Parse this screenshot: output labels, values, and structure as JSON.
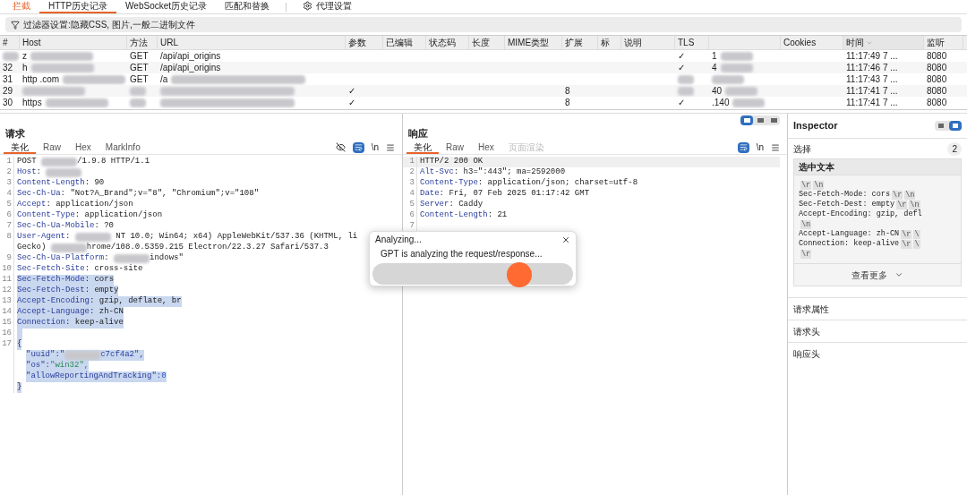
{
  "top_tabs": [
    {
      "kind": "tab",
      "label": "拦截",
      "selected": false,
      "alert": true
    },
    {
      "kind": "tab",
      "label": "HTTP历史记录",
      "selected": true,
      "alert": false
    },
    {
      "kind": "tab",
      "label": "WebSocket历史记录",
      "selected": false,
      "alert": false
    },
    {
      "kind": "tab",
      "label": "匹配和替换",
      "selected": false,
      "alert": false
    },
    {
      "kind": "settings",
      "label": "代理设置",
      "selected": false,
      "alert": false
    }
  ],
  "filter": {
    "text": "过滤器设置:隐藏CSS, 图片,一般二进制文件"
  },
  "table": {
    "columns": [
      {
        "label": "#",
        "sorted": false
      },
      {
        "label": "Host",
        "sorted": false
      },
      {
        "label": "方法",
        "sorted": false
      },
      {
        "label": "URL",
        "sorted": false
      },
      {
        "label": "参数",
        "sorted": false
      },
      {
        "label": "已编辑",
        "sorted": false
      },
      {
        "label": "状态码",
        "sorted": false
      },
      {
        "label": "长度",
        "sorted": false
      },
      {
        "label": "MIME类型",
        "sorted": false
      },
      {
        "label": "扩展",
        "sorted": false
      },
      {
        "label": "标",
        "sorted": false
      },
      {
        "label": "说明",
        "sorted": false
      },
      {
        "label": "TLS",
        "sorted": false
      },
      {
        "sorted": false
      },
      {
        "label": "Cookies",
        "sorted": false
      },
      {
        "label": "时间",
        "sorted": true
      },
      {
        "label": "监听",
        "sorted": false
      }
    ],
    "rows": [
      {
        "cells": [
          {
            "redacted": true
          },
          {
            "text": "z",
            "redacted": true
          },
          {
            "text": "GET",
            "redacted": false
          },
          {
            "text": "/api/api_origins",
            "redacted": false
          },
          null,
          null,
          null,
          null,
          null,
          null,
          null,
          null,
          {
            "text": "✓",
            "redacted": false
          },
          {
            "text": "1",
            "redacted": true
          },
          null,
          {
            "text": "11:17:49 7 ...",
            "redacted": false
          },
          {
            "text": "8080",
            "redacted": false
          }
        ]
      },
      {
        "cells": [
          {
            "text": "32",
            "redacted": false
          },
          {
            "text": "h",
            "redacted": true
          },
          {
            "text": "GET",
            "redacted": false
          },
          {
            "text": "/api/api_origins",
            "redacted": false
          },
          null,
          null,
          null,
          null,
          null,
          null,
          null,
          null,
          {
            "text": "✓",
            "redacted": false
          },
          {
            "text": "4",
            "redacted": true
          },
          null,
          {
            "text": "11:17:46 7 ...",
            "redacted": false
          },
          {
            "text": "8080",
            "redacted": false
          }
        ]
      },
      {
        "cells": [
          {
            "text": "31",
            "redacted": false
          },
          {
            "text": "http .com",
            "redacted": true
          },
          {
            "text": "GET",
            "redacted": false
          },
          {
            "text": "/a",
            "redacted": true
          },
          null,
          null,
          null,
          null,
          null,
          null,
          null,
          null,
          {
            "redacted": true
          },
          {
            "redacted": true
          },
          null,
          {
            "text": "11:17:43 7 ...",
            "redacted": false
          },
          {
            "text": "8080",
            "redacted": false
          }
        ]
      },
      {
        "cells": [
          {
            "text": "29",
            "redacted": false
          },
          {
            "redacted": true
          },
          {
            "redacted": true
          },
          {
            "redacted": true
          },
          {
            "text": "✓",
            "redacted": false
          },
          null,
          null,
          null,
          null,
          {
            "text": "8",
            "redacted": false
          },
          null,
          null,
          {
            "redacted": true
          },
          {
            "text": "40",
            "redacted": true
          },
          null,
          {
            "text": "11:17:41 7 ...",
            "redacted": false
          },
          {
            "text": "8080",
            "redacted": false
          }
        ]
      },
      {
        "cells": [
          {
            "text": "30",
            "redacted": false
          },
          {
            "text": "https",
            "redacted": true
          },
          {
            "redacted": true
          },
          {
            "redacted": true
          },
          {
            "text": "✓",
            "redacted": false
          },
          null,
          null,
          null,
          null,
          {
            "text": "8",
            "redacted": false
          },
          null,
          null,
          {
            "text": "✓",
            "redacted": false
          },
          {
            "text": ".140",
            "redacted": true
          },
          null,
          {
            "text": "11:17:41 7 ...",
            "redacted": false
          },
          {
            "text": "8080",
            "redacted": false
          }
        ]
      }
    ]
  },
  "layout_toggle": [
    {
      "selected": true
    },
    {
      "selected": false
    },
    {
      "selected": false
    }
  ],
  "request": {
    "title": "请求",
    "tabs": [
      {
        "label": "美化",
        "selected": true,
        "disabled": false
      },
      {
        "label": "Raw",
        "selected": false,
        "disabled": false
      },
      {
        "label": "Hex",
        "selected": false,
        "disabled": false
      },
      {
        "label": "MarkInfo",
        "selected": false,
        "disabled": false
      }
    ],
    "tools": {
      "hide_icon": true,
      "wrap_on": true,
      "newline": "\\n"
    },
    "lines": [
      {
        "num": "1",
        "current": false,
        "selected": false,
        "segments": [
          {
            "kind": "plain",
            "text": "POST "
          },
          {
            "kind": "redacted"
          },
          {
            "kind": "plain",
            "text": "/1.9.8 HTTP/1.1"
          }
        ]
      },
      {
        "num": "2",
        "current": false,
        "selected": false,
        "segments": [
          {
            "kind": "key",
            "text": "Host"
          },
          {
            "kind": "plain",
            "text": ": "
          },
          {
            "kind": "redacted"
          }
        ]
      },
      {
        "num": "3",
        "current": false,
        "selected": false,
        "segments": [
          {
            "kind": "key",
            "text": "Content-Length"
          },
          {
            "kind": "plain",
            "text": ": 90"
          }
        ]
      },
      {
        "num": "4",
        "current": false,
        "selected": false,
        "segments": [
          {
            "kind": "key",
            "text": "Sec-Ch-Ua"
          },
          {
            "kind": "plain",
            "text": ": \"Not?A_Brand\";v=\"8\", \"Chromium\";v=\"108\""
          }
        ]
      },
      {
        "num": "5",
        "current": false,
        "selected": false,
        "segments": [
          {
            "kind": "key",
            "text": "Accept"
          },
          {
            "kind": "plain",
            "text": ": application/json"
          }
        ]
      },
      {
        "num": "6",
        "current": false,
        "selected": false,
        "segments": [
          {
            "kind": "key",
            "text": "Content-Type"
          },
          {
            "kind": "plain",
            "text": ": application/json"
          }
        ]
      },
      {
        "num": "7",
        "current": false,
        "selected": false,
        "segments": [
          {
            "kind": "key",
            "text": "Sec-Ch-Ua-Mobile"
          },
          {
            "kind": "plain",
            "text": ": ?0"
          }
        ]
      },
      {
        "num": "8",
        "current": false,
        "selected": false,
        "segments": [
          {
            "kind": "key",
            "text": "User-Agent"
          },
          {
            "kind": "plain",
            "text": ": "
          },
          {
            "kind": "redacted"
          },
          {
            "kind": "plain",
            "text": " NT 10.0; Win64; x64) AppleWebKit/537.36 (KHTML, li"
          }
        ]
      },
      {
        "current": false,
        "selected": false,
        "segments": [
          {
            "kind": "plain",
            "text": "Gecko) "
          },
          {
            "kind": "redacted"
          },
          {
            "kind": "plain",
            "text": "hrome/108.0.5359.215 Electron/22.3.27 Safari/537.3"
          }
        ]
      },
      {
        "num": "9",
        "current": false,
        "selected": false,
        "segments": [
          {
            "kind": "key",
            "text": "Sec-Ch-Ua-Platform"
          },
          {
            "kind": "plain",
            "text": ": "
          },
          {
            "kind": "redacted"
          },
          {
            "kind": "plain",
            "text": "indows\""
          }
        ]
      },
      {
        "num": "10",
        "current": false,
        "selected": false,
        "segments": [
          {
            "kind": "key",
            "text": "Sec-Fetch-Site"
          },
          {
            "kind": "plain",
            "text": ": cross-site"
          }
        ]
      },
      {
        "num": "11",
        "current": false,
        "selected": true,
        "segments": [
          {
            "kind": "key",
            "text": "Sec-Fetch-Mode"
          },
          {
            "kind": "plain",
            "text": ": cors"
          }
        ]
      },
      {
        "num": "12",
        "current": false,
        "selected": true,
        "segments": [
          {
            "kind": "key",
            "text": "Sec-Fetch-Dest"
          },
          {
            "kind": "plain",
            "text": ": empty"
          }
        ]
      },
      {
        "num": "13",
        "current": false,
        "selected": true,
        "segments": [
          {
            "kind": "key",
            "text": "Accept-Encoding"
          },
          {
            "kind": "plain",
            "text": ": gzip, deflate, br"
          }
        ]
      },
      {
        "num": "14",
        "current": false,
        "selected": true,
        "segments": [
          {
            "kind": "key",
            "text": "Accept-Language"
          },
          {
            "kind": "plain",
            "text": ": zh-CN"
          }
        ]
      },
      {
        "num": "15",
        "current": false,
        "selected": true,
        "segments": [
          {
            "kind": "key",
            "text": "Connection"
          },
          {
            "kind": "plain",
            "text": ": keep-alive"
          }
        ]
      },
      {
        "num": "16",
        "current": false,
        "selected": true
      },
      {
        "num": "17",
        "current": false,
        "selected": true,
        "segments": [
          {
            "kind": "plain",
            "text": "{"
          }
        ],
        "children": [
          {
            "current": false,
            "selected": true,
            "segments": [
              {
                "kind": "key",
                "text": "\"uuid\":\""
              },
              {
                "kind": "redacted"
              },
              {
                "kind": "key",
                "text": "c7cf4a2\","
              }
            ]
          },
          {
            "current": false,
            "selected": true,
            "segments": [
              {
                "kind": "key",
                "text": "\"os\":"
              },
              {
                "kind": "string",
                "text": "\"win32\","
              }
            ]
          },
          {
            "current": false,
            "selected": true,
            "segments": [
              {
                "kind": "key",
                "text": "\"allowReportingAndTracking\":"
              },
              {
                "kind": "number",
                "text": "0"
              }
            ]
          }
        ]
      },
      {
        "current": false,
        "selected": true,
        "segments": [
          {
            "kind": "plain",
            "text": "}"
          }
        ]
      }
    ]
  },
  "response": {
    "title": "响应",
    "tabs": [
      {
        "label": "美化",
        "selected": true,
        "disabled": false
      },
      {
        "label": "Raw",
        "selected": false,
        "disabled": false
      },
      {
        "label": "Hex",
        "selected": false,
        "disabled": false
      },
      {
        "label": "页面渲染",
        "selected": false,
        "disabled": true
      }
    ],
    "tools": {
      "hide_icon": false,
      "wrap_on": true,
      "newline": "\\n"
    },
    "lines": [
      {
        "num": "1",
        "current": true,
        "selected": false,
        "segments": [
          {
            "kind": "plain",
            "text": "HTTP/2 200 OK"
          }
        ]
      },
      {
        "num": "2",
        "current": false,
        "selected": false,
        "segments": [
          {
            "kind": "key",
            "text": "Alt-Svc"
          },
          {
            "kind": "plain",
            "text": ": h3=\":443\"; ma=2592000"
          }
        ]
      },
      {
        "num": "3",
        "current": false,
        "selected": false,
        "segments": [
          {
            "kind": "key",
            "text": "Content-Type"
          },
          {
            "kind": "plain",
            "text": ": application/json; charset=utf-8"
          }
        ]
      },
      {
        "num": "4",
        "current": false,
        "selected": false,
        "segments": [
          {
            "kind": "key",
            "text": "Date"
          },
          {
            "kind": "plain",
            "text": ": Fri, 07 Feb 2025 01:17:42 GMT"
          }
        ]
      },
      {
        "num": "5",
        "current": false,
        "selected": false,
        "segments": [
          {
            "kind": "key",
            "text": "Server"
          },
          {
            "kind": "plain",
            "text": ": Caddy"
          }
        ]
      },
      {
        "num": "6",
        "current": false,
        "selected": false,
        "segments": [
          {
            "kind": "key",
            "text": "Content-Length"
          },
          {
            "kind": "plain",
            "text": ": 21"
          }
        ]
      },
      {
        "num": "7",
        "current": false,
        "selected": false
      }
    ]
  },
  "inspector": {
    "title": "Inspector",
    "view_toggle": [
      {
        "selected": false
      },
      {
        "selected": true
      }
    ],
    "selection": {
      "label": "选择",
      "count": "2"
    },
    "selected_text": {
      "title": "选中文本",
      "lines": [
        {
          "chips": [
            "\\r",
            "\\n"
          ]
        },
        {
          "text": "Sec-Fetch-Mode: cors",
          "chips": [
            "\\r",
            "\\n"
          ]
        },
        {
          "text": "Sec-Fetch-Dest: empty",
          "chips": [
            "\\r",
            "\\n"
          ]
        },
        {
          "text": "Accept-Encoding: gzip, defl"
        },
        {
          "chips": [
            "\\n"
          ]
        },
        {
          "text": "Accept-Language: zh-CN",
          "chips": [
            "\\r",
            "\\"
          ]
        },
        {
          "text": "Connection: keep-alive",
          "chips": [
            "\\r",
            "\\"
          ]
        },
        {
          "chips": [
            "\\r"
          ]
        }
      ],
      "more": "查看更多"
    },
    "sections": [
      "请求属性",
      "请求头",
      "响应头"
    ]
  },
  "dialog": {
    "title": "Analyzing...",
    "message": "GPT is analyzing the request/response...",
    "level": 0.73
  }
}
